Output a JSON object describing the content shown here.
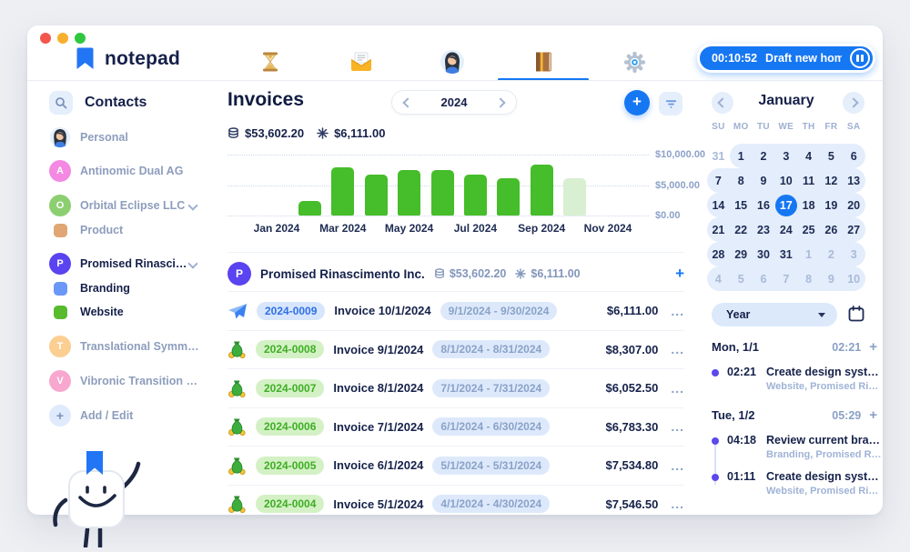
{
  "app": {
    "logo_text": "notepad"
  },
  "topbar": {
    "tabs": [
      {
        "icon": "hourglass-icon",
        "active": false
      },
      {
        "icon": "mail-icon",
        "active": false
      },
      {
        "icon": "avatar-icon",
        "active": false
      },
      {
        "icon": "ledger-icon",
        "active": true
      },
      {
        "icon": "gear-icon",
        "active": false
      }
    ],
    "timer": {
      "time": "00:10:52",
      "task": "Draft new homep..."
    }
  },
  "sidebar": {
    "title": "Contacts",
    "items": [
      {
        "label": "Personal",
        "icon": "person-avatar",
        "active": false
      },
      {
        "label": "Antinomic Dual AG",
        "initial": "A",
        "color": "#f389e2",
        "active": false
      },
      {
        "label": "Orbital Eclipse LLC",
        "initial": "O",
        "color": "#8ccf70",
        "chevron": true,
        "active": false
      },
      {
        "label": "Product",
        "swatch": "#e0a674",
        "active": false
      },
      {
        "label": "Promised Rinascimen...",
        "initial": "P",
        "color": "#5a43f0",
        "chevron": true,
        "active": true
      },
      {
        "label": "Branding",
        "swatch": "#6b97f8",
        "active": true
      },
      {
        "label": "Website",
        "swatch": "#58bb2e",
        "active": true
      },
      {
        "label": "Translational Symmet...",
        "initial": "T",
        "color": "#fbce92",
        "active": false
      },
      {
        "label": "Vibronic Transition G...",
        "initial": "V",
        "color": "#f8a8cf",
        "active": false
      },
      {
        "label": "Add / Edit",
        "initial": "+",
        "color": "#dfeafc",
        "add": true,
        "active": false
      }
    ]
  },
  "main": {
    "title": "Invoices",
    "year": "2024",
    "totals": {
      "billed": "$53,602.20",
      "outstanding": "$6,111.00"
    },
    "row_menu": "...",
    "plus": "+",
    "contact_row": {
      "initial": "P",
      "color": "#5a43f0",
      "name": "Promised Rinascimento Inc.",
      "billed": "$53,602.20",
      "outstanding": "$6,111.00"
    },
    "invoices": [
      {
        "id": "2024-0009",
        "title": "Invoice 10/1/2024",
        "period": "9/1/2024 - 9/30/2024",
        "amount": "$6,111.00",
        "icon": "paper-plane-icon",
        "badge": "blue"
      },
      {
        "id": "2024-0008",
        "title": "Invoice 9/1/2024",
        "period": "8/1/2024 - 8/31/2024",
        "amount": "$8,307.00",
        "icon": "money-bag-icon",
        "badge": "green"
      },
      {
        "id": "2024-0007",
        "title": "Invoice 8/1/2024",
        "period": "7/1/2024 - 7/31/2024",
        "amount": "$6,052.50",
        "icon": "money-bag-icon",
        "badge": "green"
      },
      {
        "id": "2024-0006",
        "title": "Invoice 7/1/2024",
        "period": "6/1/2024 - 6/30/2024",
        "amount": "$6,783.30",
        "icon": "money-bag-icon",
        "badge": "green"
      },
      {
        "id": "2024-0005",
        "title": "Invoice 6/1/2024",
        "period": "5/1/2024 - 5/31/2024",
        "amount": "$7,534.80",
        "icon": "money-bag-icon",
        "badge": "green"
      },
      {
        "id": "2024-0004",
        "title": "Invoice 5/1/2024",
        "period": "4/1/2024 - 4/30/2024",
        "amount": "$7,546.50",
        "icon": "money-bag-icon",
        "badge": "green"
      }
    ]
  },
  "chart_data": {
    "type": "bar",
    "categories": [
      "Jan 2024",
      "Feb 2024",
      "Mar 2024",
      "Apr 2024",
      "May 2024",
      "Jun 2024",
      "Jul 2024",
      "Aug 2024",
      "Sep 2024",
      "Oct 2024",
      "Nov 2024",
      "Dec 2024"
    ],
    "values": [
      0,
      2400,
      7960,
      6750,
      7450,
      7430,
      6780,
      6050,
      8300,
      6111,
      0,
      0
    ],
    "pending_index": 9,
    "x_tick_labels": [
      "Jan 2024",
      "Mar 2024",
      "May 2024",
      "Jul 2024",
      "Sep 2024",
      "Nov 2024"
    ],
    "y_ticks": [
      "$10,000.00",
      "$5,000.00",
      "$0.00"
    ],
    "ylim": [
      0,
      10000
    ],
    "bar_color": "#46bd2a",
    "pending_color": "#d9efd2",
    "grid": "dotted"
  },
  "calendar": {
    "month": "January",
    "weekdays": [
      "SU",
      "MO",
      "TU",
      "WE",
      "TH",
      "FR",
      "SA"
    ],
    "weeks": [
      [
        {
          "d": "31",
          "out": true,
          "pill": false
        },
        {
          "d": "1"
        },
        {
          "d": "2"
        },
        {
          "d": "3"
        },
        {
          "d": "4"
        },
        {
          "d": "5"
        },
        {
          "d": "6"
        }
      ],
      [
        {
          "d": "7"
        },
        {
          "d": "8"
        },
        {
          "d": "9"
        },
        {
          "d": "10"
        },
        {
          "d": "11"
        },
        {
          "d": "12"
        },
        {
          "d": "13"
        }
      ],
      [
        {
          "d": "14"
        },
        {
          "d": "15"
        },
        {
          "d": "16"
        },
        {
          "d": "17",
          "sel": true
        },
        {
          "d": "18"
        },
        {
          "d": "19"
        },
        {
          "d": "20"
        }
      ],
      [
        {
          "d": "21"
        },
        {
          "d": "22"
        },
        {
          "d": "23"
        },
        {
          "d": "24"
        },
        {
          "d": "25"
        },
        {
          "d": "26"
        },
        {
          "d": "27"
        }
      ],
      [
        {
          "d": "28"
        },
        {
          "d": "29"
        },
        {
          "d": "30"
        },
        {
          "d": "31"
        },
        {
          "d": "1",
          "out": true
        },
        {
          "d": "2",
          "out": true
        },
        {
          "d": "3",
          "out": true
        }
      ],
      [
        {
          "d": "4",
          "out": true
        },
        {
          "d": "5",
          "out": true
        },
        {
          "d": "6",
          "out": true
        },
        {
          "d": "7",
          "out": true
        },
        {
          "d": "8",
          "out": true
        },
        {
          "d": "9",
          "out": true
        },
        {
          "d": "10",
          "out": true
        }
      ]
    ],
    "year_dropdown_label": "Year"
  },
  "schedule": {
    "plus": "+",
    "days": [
      {
        "label": "Mon, 1/1",
        "total": "02:21",
        "entries": [
          {
            "time": "02:21",
            "title": "Create design system",
            "tags": "Website, Promised Rinas..."
          }
        ]
      },
      {
        "label": "Tue, 1/2",
        "total": "05:29",
        "entries": [
          {
            "time": "04:18",
            "title": "Review current brand...",
            "tags": "Branding, Promised Rinas..."
          },
          {
            "time": "01:11",
            "title": "Create design system",
            "tags": "Website, Promised Rinas..."
          }
        ]
      }
    ]
  }
}
